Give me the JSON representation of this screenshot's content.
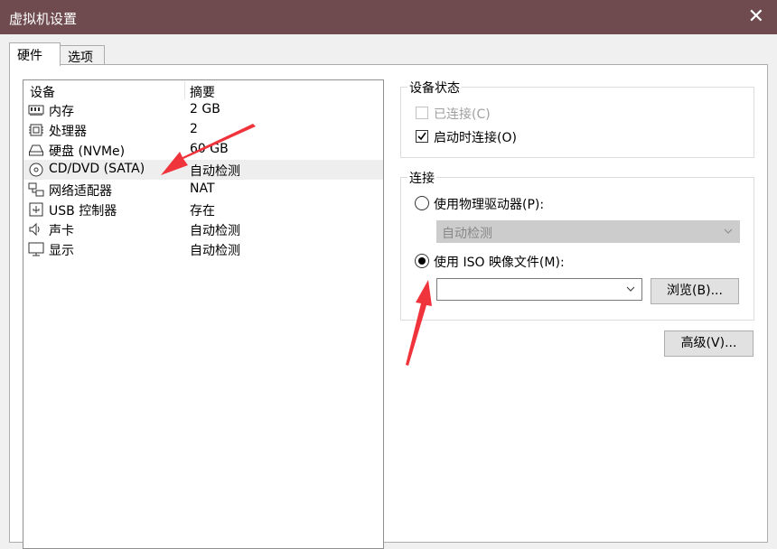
{
  "window": {
    "title": "虚拟机设置",
    "close_glyph": "✕"
  },
  "tabs": [
    {
      "label": "硬件"
    },
    {
      "label": "选项"
    }
  ],
  "device_list": {
    "headers": {
      "device": "设备",
      "summary": "摘要"
    },
    "rows": [
      {
        "name": "内存",
        "summary": "2 GB",
        "icon": "memory-icon"
      },
      {
        "name": "处理器",
        "summary": "2",
        "icon": "processor-icon"
      },
      {
        "name": "硬盘 (NVMe)",
        "summary": "60 GB",
        "icon": "hard-disk-icon"
      },
      {
        "name": "CD/DVD (SATA)",
        "summary": "自动检测",
        "icon": "cd-dvd-icon",
        "selected": true
      },
      {
        "name": "网络适配器",
        "summary": "NAT",
        "icon": "network-adapter-icon"
      },
      {
        "name": "USB 控制器",
        "summary": "存在",
        "icon": "usb-controller-icon"
      },
      {
        "name": "声卡",
        "summary": "自动检测",
        "icon": "sound-card-icon"
      },
      {
        "name": "显示",
        "summary": "自动检测",
        "icon": "display-icon"
      }
    ]
  },
  "device_status": {
    "legend": "设备状态",
    "connected": {
      "label": "已连接(C)",
      "checked": false,
      "enabled": false
    },
    "connect_at_power_on": {
      "label": "启动时连接(O)",
      "checked": true,
      "enabled": true
    }
  },
  "connection": {
    "legend": "连接",
    "physical_drive": {
      "label": "使用物理驱动器(P):",
      "selected": false
    },
    "physical_drive_select": {
      "value": "自动检测",
      "enabled": false
    },
    "iso_image": {
      "label": "使用 ISO 映像文件(M):",
      "selected": true
    },
    "iso_path": {
      "value": ""
    },
    "browse_button": "浏览(B)..."
  },
  "advanced_button": "高级(V)...",
  "annotation_color": "#f0343c"
}
